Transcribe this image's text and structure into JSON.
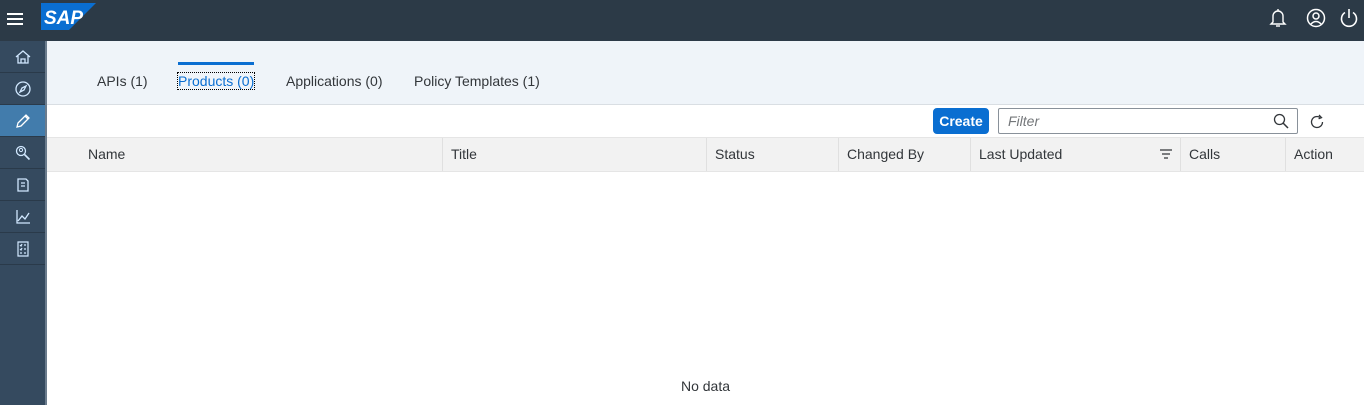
{
  "shell": {
    "logo_text": "SAP",
    "icons": [
      "menu-icon",
      "bell-icon",
      "user-icon",
      "power-icon"
    ]
  },
  "sidebar": {
    "items": [
      {
        "icon": "home-icon",
        "active": false
      },
      {
        "icon": "compass-icon",
        "active": false
      },
      {
        "icon": "pencil-icon",
        "active": true
      },
      {
        "icon": "search-people-icon",
        "active": false
      },
      {
        "icon": "document-icon",
        "active": false
      },
      {
        "icon": "line-chart-icon",
        "active": false
      },
      {
        "icon": "checklist-icon",
        "active": false
      }
    ]
  },
  "tabs": [
    {
      "label": "APIs (1)",
      "active": false
    },
    {
      "label": "Products (0)",
      "active": true
    },
    {
      "label": "Applications (0)",
      "active": false
    },
    {
      "label": "Policy Templates (1)",
      "active": false
    }
  ],
  "toolbar": {
    "create_label": "Create",
    "filter_placeholder": "Filter"
  },
  "table": {
    "columns": [
      "Name",
      "Title",
      "Status",
      "Changed By",
      "Last Updated",
      "Calls",
      "Action"
    ],
    "empty_text": "No data"
  },
  "colors": {
    "shell_bg": "#2c3a47",
    "sidenav_bg": "#354a5f",
    "active_nav": "#427cac",
    "accent": "#0a6ed1",
    "tabbar_bg": "#eff4f9"
  }
}
